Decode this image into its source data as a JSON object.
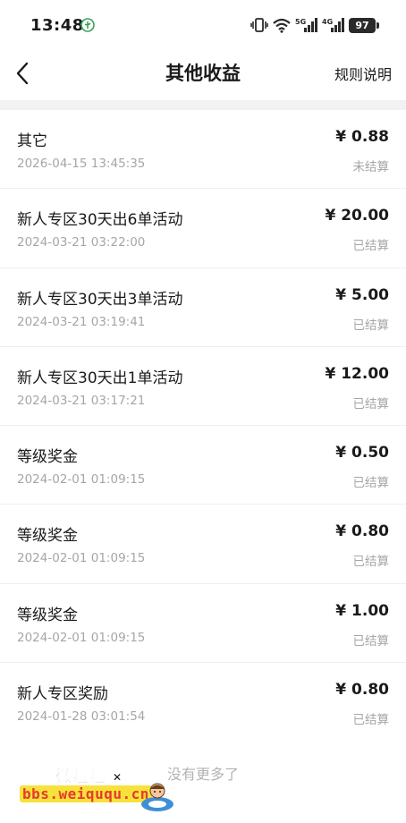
{
  "status_bar": {
    "time": "13:48",
    "network_5g": "5G",
    "network_4g": "4G",
    "battery": "97"
  },
  "header": {
    "title": "其他收益",
    "rules_label": "规则说明"
  },
  "earnings": [
    {
      "title": "其它",
      "time": "2026-04-15 13:45:35",
      "amount": "¥ 0.88",
      "status": "未结算"
    },
    {
      "title": "新人专区30天出6单活动",
      "time": "2024-03-21 03:22:00",
      "amount": "¥ 20.00",
      "status": "已结算"
    },
    {
      "title": "新人专区30天出3单活动",
      "time": "2024-03-21 03:19:41",
      "amount": "¥ 5.00",
      "status": "已结算"
    },
    {
      "title": "新人专区30天出1单活动",
      "time": "2024-03-21 03:17:21",
      "amount": "¥ 12.00",
      "status": "已结算"
    },
    {
      "title": "等级奖金",
      "time": "2024-02-01 01:09:15",
      "amount": "¥ 0.50",
      "status": "已结算"
    },
    {
      "title": "等级奖金",
      "time": "2024-02-01 01:09:15",
      "amount": "¥ 0.80",
      "status": "已结算"
    },
    {
      "title": "等级奖金",
      "time": "2024-02-01 01:09:15",
      "amount": "¥ 1.00",
      "status": "已结算"
    },
    {
      "title": "新人专区奖励",
      "time": "2024-01-28 03:01:54",
      "amount": "¥ 0.80",
      "status": "已结算"
    }
  ],
  "footer": {
    "no_more": "没有更多了"
  },
  "watermark": {
    "cn": "微趣趣",
    "url": "bbs.weiququ.cn"
  }
}
